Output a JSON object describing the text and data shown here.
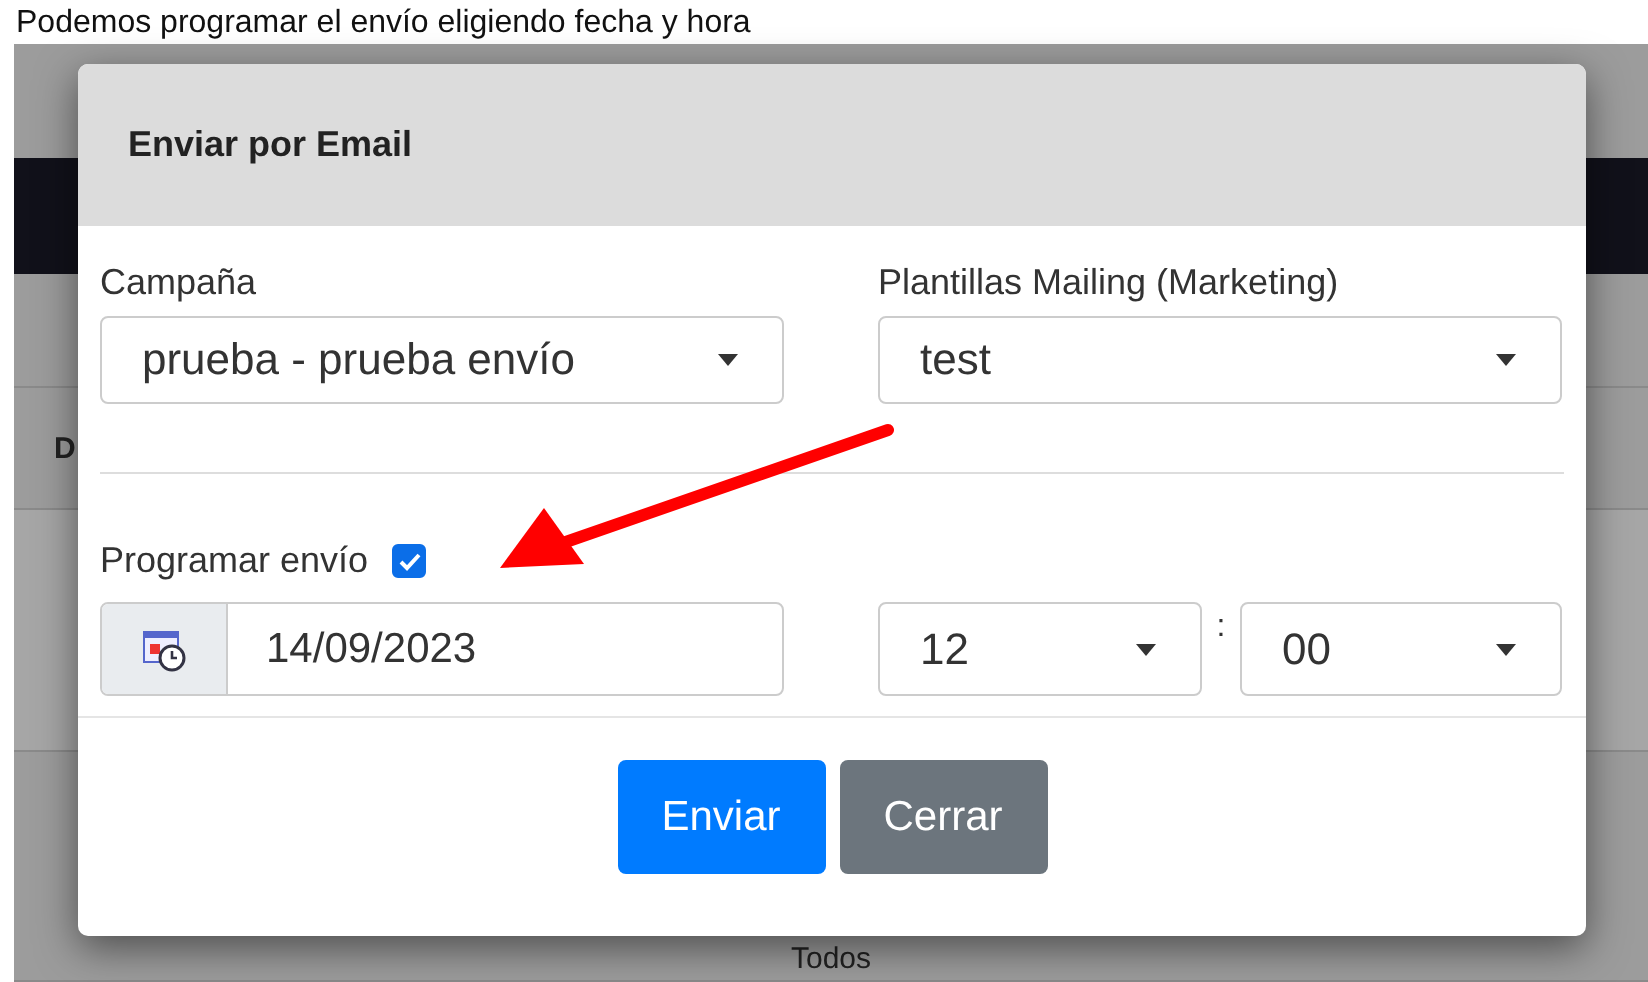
{
  "caption": "Podemos programar el envío eligiendo fecha y hora",
  "background": {
    "column_header": "D",
    "cell": "Todos"
  },
  "modal": {
    "title": "Enviar por Email",
    "fields": [
      {
        "label": "Campaña",
        "value": "prueba - prueba envío"
      },
      {
        "label": "Plantillas Mailing (Marketing)",
        "value": "test"
      }
    ],
    "schedule": {
      "label": "Programar envío",
      "checked": true,
      "date": "14/09/2023",
      "hour": "12",
      "separator": ":",
      "minute": "00"
    },
    "buttons": [
      {
        "label": "Enviar",
        "kind": "primary"
      },
      {
        "label": "Cerrar",
        "kind": "secondary"
      }
    ]
  }
}
